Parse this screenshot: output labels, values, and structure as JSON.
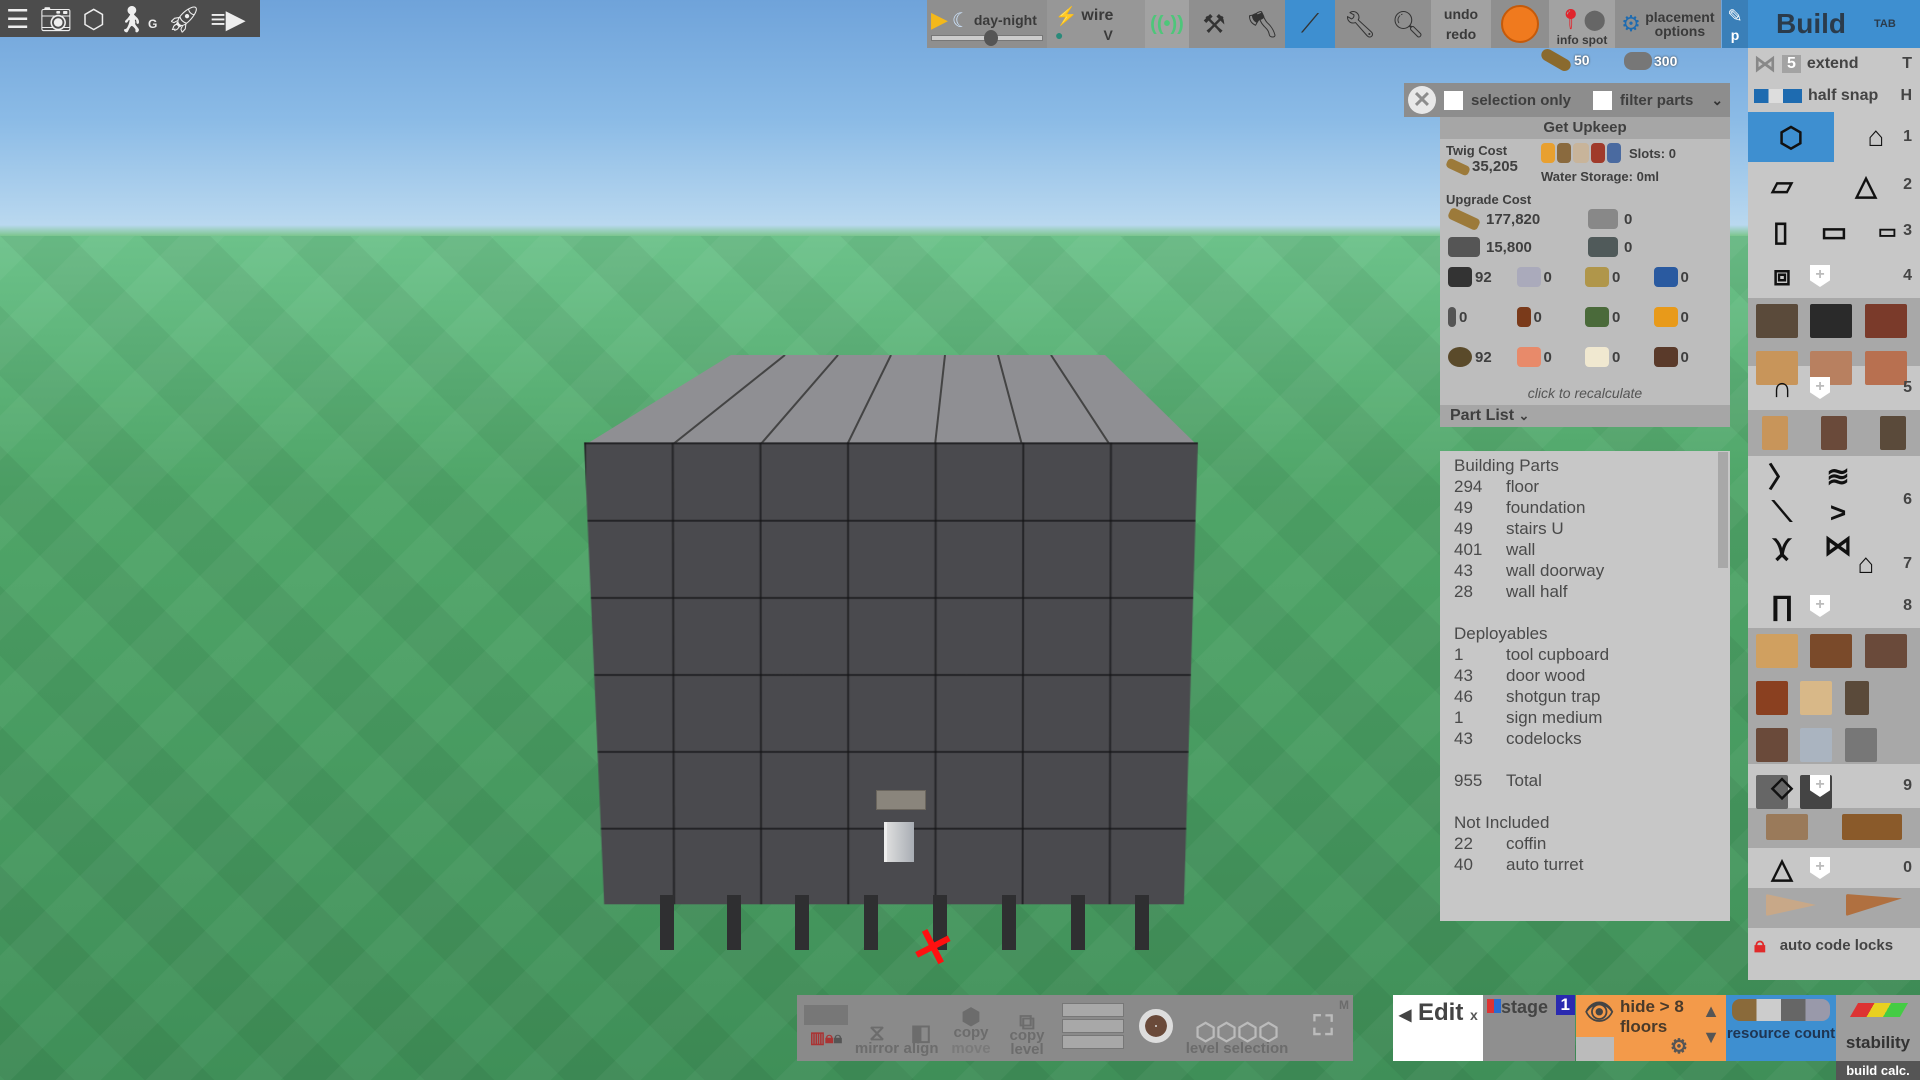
{
  "top_left_toolbar": {
    "icons": [
      "menu-icon",
      "camera-icon",
      "cube-icon",
      "walk-icon",
      "rocket-camera-icon",
      "camera-list-icon"
    ],
    "walk_key": "G"
  },
  "top_toolbar": {
    "day_night_label": "day-night",
    "day_night_slider": 0.5,
    "wire_label": "wire",
    "wire_key": "V",
    "undo_label": "undo",
    "redo_label": "redo",
    "info_spot_label": "info spot",
    "placement_options_label": "placement options",
    "picker_key": "p",
    "build_label": "Build",
    "build_key": "TAB",
    "selected_tool": "trowel",
    "accent": "#3e8fd0"
  },
  "resources_hud": {
    "wood": "50",
    "stone": "300"
  },
  "upkeep_panel": {
    "selection_only_label": "selection only",
    "filter_parts_label": "filter parts",
    "get_upkeep_label": "Get Upkeep",
    "twig_cost_label": "Twig Cost",
    "twig_cost_value": "35,205",
    "slots_label": "Slots: 0",
    "water_storage_label": "Water Storage: 0ml",
    "upgrade_cost_label": "Upgrade Cost",
    "upgrade_costs": [
      {
        "resource": "wood",
        "value": "177,820"
      },
      {
        "resource": "stone",
        "value": "0"
      },
      {
        "resource": "metal-fragments",
        "value": "15,800"
      },
      {
        "resource": "hq-metal",
        "value": "0"
      }
    ],
    "component_costs": [
      {
        "resource": "gears",
        "value": "92"
      },
      {
        "resource": "sheet-metal",
        "value": "0"
      },
      {
        "resource": "sewing-kit",
        "value": "0"
      },
      {
        "resource": "tarp",
        "value": "0"
      },
      {
        "resource": "metal-pipe",
        "value": "0"
      },
      {
        "resource": "wood-log",
        "value": "0"
      },
      {
        "resource": "cloth",
        "value": "0"
      },
      {
        "resource": "low-grade-fuel",
        "value": "0"
      },
      {
        "resource": "rope",
        "value": "92"
      },
      {
        "resource": "leather",
        "value": "0"
      },
      {
        "resource": "animal-fat",
        "value": "0"
      },
      {
        "resource": "scrap",
        "value": "0"
      }
    ],
    "recalculate_label": "click to recalculate"
  },
  "part_list": {
    "header": "Part List",
    "sections": [
      {
        "title": "Building Parts",
        "items": [
          {
            "count": "294",
            "name": "floor"
          },
          {
            "count": "49",
            "name": "foundation"
          },
          {
            "count": "49",
            "name": "stairs U"
          },
          {
            "count": "401",
            "name": "wall"
          },
          {
            "count": "43",
            "name": "wall doorway"
          },
          {
            "count": "28",
            "name": "wall half"
          }
        ]
      },
      {
        "title": "Deployables",
        "items": [
          {
            "count": "1",
            "name": "tool cupboard"
          },
          {
            "count": "43",
            "name": "door wood"
          },
          {
            "count": "46",
            "name": "shotgun trap"
          },
          {
            "count": "1",
            "name": "sign medium"
          },
          {
            "count": "43",
            "name": "codelocks"
          }
        ]
      }
    ],
    "total_count": "955",
    "total_label": "Total",
    "not_included_title": "Not Included",
    "not_included": [
      {
        "count": "22",
        "name": "coffin"
      },
      {
        "count": "40",
        "name": "auto turret"
      }
    ]
  },
  "build_panel": {
    "extend_count": "5",
    "extend_label": "extend",
    "extend_key": "T",
    "half_snap_label": "half snap",
    "half_snap_key": "H",
    "category_keys": [
      "1",
      "2",
      "3",
      "4",
      "5",
      "6",
      "7",
      "8",
      "9",
      "0"
    ],
    "auto_code_locks_label": "auto code locks"
  },
  "bottom_bar": {
    "mirror_label": "mirror",
    "align_label": "align",
    "copy_label": "copy",
    "move_label": "move",
    "copy_level_label": "copy level",
    "level_selection_label": "level selection",
    "m_key": "M",
    "edit_label": "Edit",
    "edit_close": "x",
    "stage_label": "stage",
    "stage_number": "1",
    "hide_floors_label": "hide > 8 floors",
    "resource_count_label": "resource count",
    "stability_label": "stability",
    "build_calc_label": "build calc."
  }
}
